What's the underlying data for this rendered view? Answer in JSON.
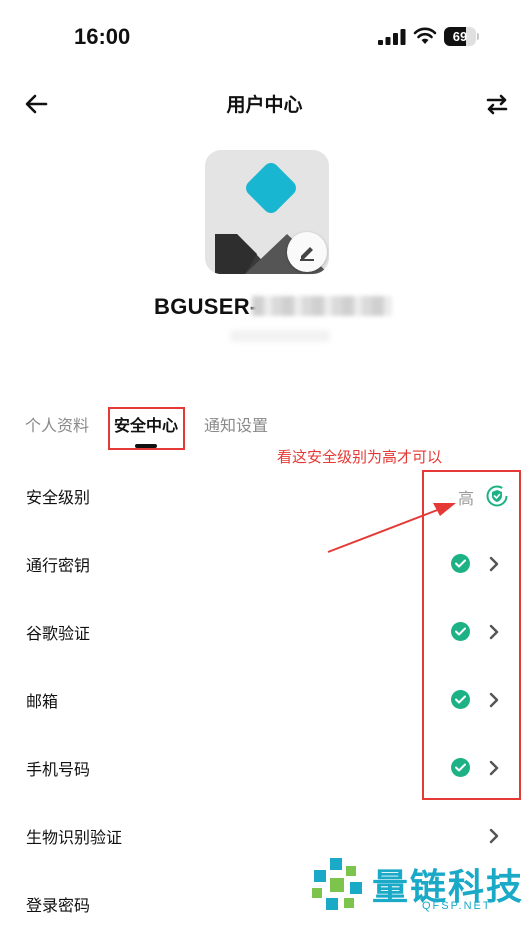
{
  "status_bar": {
    "time": "16:00",
    "battery": "69",
    "battery_level": 0.69
  },
  "header": {
    "title": "用户中心"
  },
  "user": {
    "name": "BGUSER-"
  },
  "tabs": [
    {
      "label": "个人资料",
      "active": false
    },
    {
      "label": "安全中心",
      "active": true
    },
    {
      "label": "通知设置",
      "active": false
    }
  ],
  "annotation": {
    "text": "看这安全级别为高才可以"
  },
  "security": {
    "level_label": "安全级别",
    "level_value": "高",
    "items": [
      {
        "label": "通行密钥",
        "verified": true
      },
      {
        "label": "谷歌验证",
        "verified": true
      },
      {
        "label": "邮箱",
        "verified": true
      },
      {
        "label": "手机号码",
        "verified": true
      },
      {
        "label": "生物识别验证",
        "verified": false
      },
      {
        "label": "登录密码",
        "verified": false
      }
    ]
  },
  "watermark": {
    "name": "量链科技",
    "domain": "QFSP.NET"
  },
  "colors": {
    "accent": "#1cb285",
    "annotation": "#e53935",
    "watermark": "#1aa9c7",
    "avatar_diamond": "#19b6d2"
  }
}
